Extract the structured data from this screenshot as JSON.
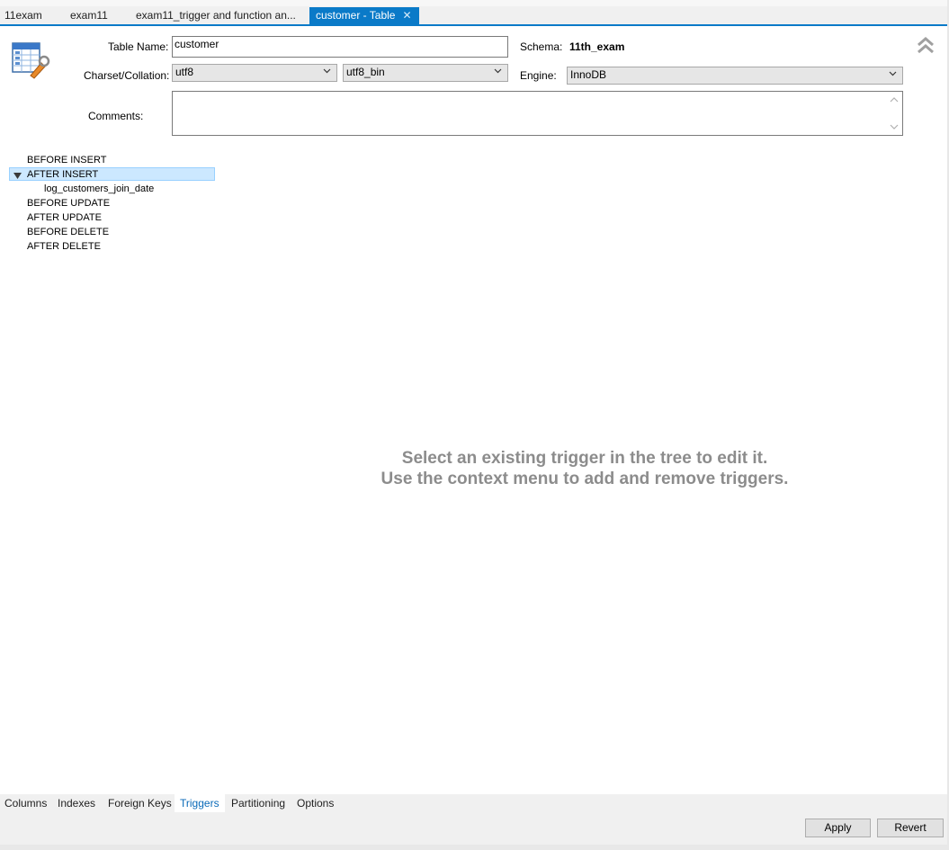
{
  "tabs": [
    {
      "label": "11exam"
    },
    {
      "label": "exam11"
    },
    {
      "label": "exam11_trigger and function an..."
    },
    {
      "label": "customer - Table",
      "close": "✕"
    }
  ],
  "form": {
    "table_name_label": "Table Name:",
    "table_name_value": "customer",
    "schema_label": "Schema:",
    "schema_value": "11th_exam",
    "charset_label": "Charset/Collation:",
    "charset_value": "utf8",
    "collation_value": "utf8_bin",
    "engine_label": "Engine:",
    "engine_value": "InnoDB",
    "comments_label": "Comments:",
    "comments_value": ""
  },
  "tree": {
    "items": [
      {
        "label": "BEFORE INSERT"
      },
      {
        "label": "AFTER INSERT",
        "expanded": true,
        "selected": true
      },
      {
        "label": "log_customers_join_date",
        "child": true
      },
      {
        "label": "BEFORE UPDATE"
      },
      {
        "label": "AFTER UPDATE"
      },
      {
        "label": "BEFORE DELETE"
      },
      {
        "label": "AFTER DELETE"
      }
    ]
  },
  "hint": {
    "line1": "Select an existing trigger in the tree to edit it.",
    "line2": "Use the context menu to add and remove triggers."
  },
  "bottom_tabs": [
    {
      "label": "Columns"
    },
    {
      "label": "Indexes"
    },
    {
      "label": "Foreign Keys"
    },
    {
      "label": "Triggers",
      "active": true
    },
    {
      "label": "Partitioning"
    },
    {
      "label": "Options"
    }
  ],
  "buttons": {
    "apply": "Apply",
    "revert": "Revert"
  },
  "colors": {
    "accent": "#0a7ac8",
    "selection": "#cce8ff",
    "hint_text": "#8c8c8c"
  }
}
